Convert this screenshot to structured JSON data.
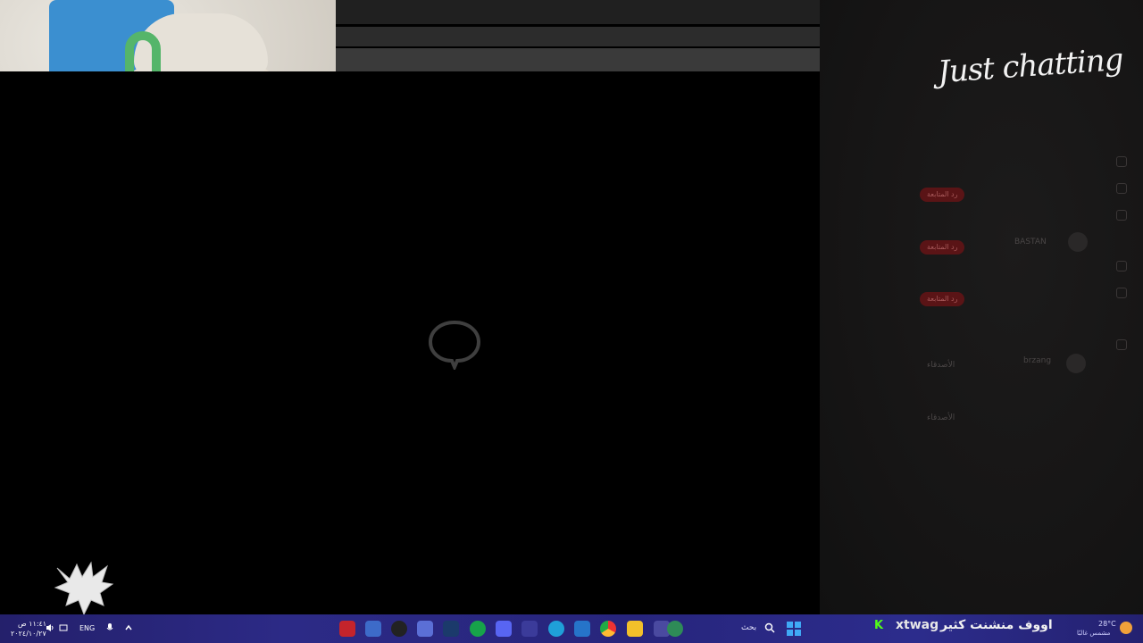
{
  "overlay": {
    "category_title": "Just chatting"
  },
  "main": {
    "loading_icon": "chat-bubble-icon"
  },
  "side_panel": {
    "pills": [
      "رد المتابعة",
      "رد المتابعة",
      "رد المتابعة"
    ],
    "names": [
      "BASTAN",
      "brzang"
    ],
    "labels": [
      "الأصدقاء",
      "الأصدقاء"
    ]
  },
  "ticker": {
    "platform_icon": "kick-logo-icon",
    "platform_letter": "K",
    "username": "xtwag",
    "message": "اووف منشنت كثير"
  },
  "taskbar": {
    "clock_time": "١١:٤١ ص",
    "clock_date": "٢٠٢٤/١٠/٢٧",
    "language": "ENG",
    "weather_temp": "28°C",
    "weather_desc": "مشمس غالبًا",
    "search_label": "بحث",
    "apps": [
      "youtube-icon",
      "shield-app-icon",
      "github-icon",
      "window-app-icon",
      "steam-icon",
      "xbox-icon",
      "discord-icon",
      "store-icon",
      "edge-icon",
      "mail-icon",
      "chrome-icon",
      "explorer-icon",
      "network-app-icon",
      "game-app-icon"
    ]
  },
  "colors": {
    "taskbar": "#2a2880",
    "panel": "#161515",
    "kick_green": "#53fc18",
    "pill_bg": "#5a1416"
  }
}
